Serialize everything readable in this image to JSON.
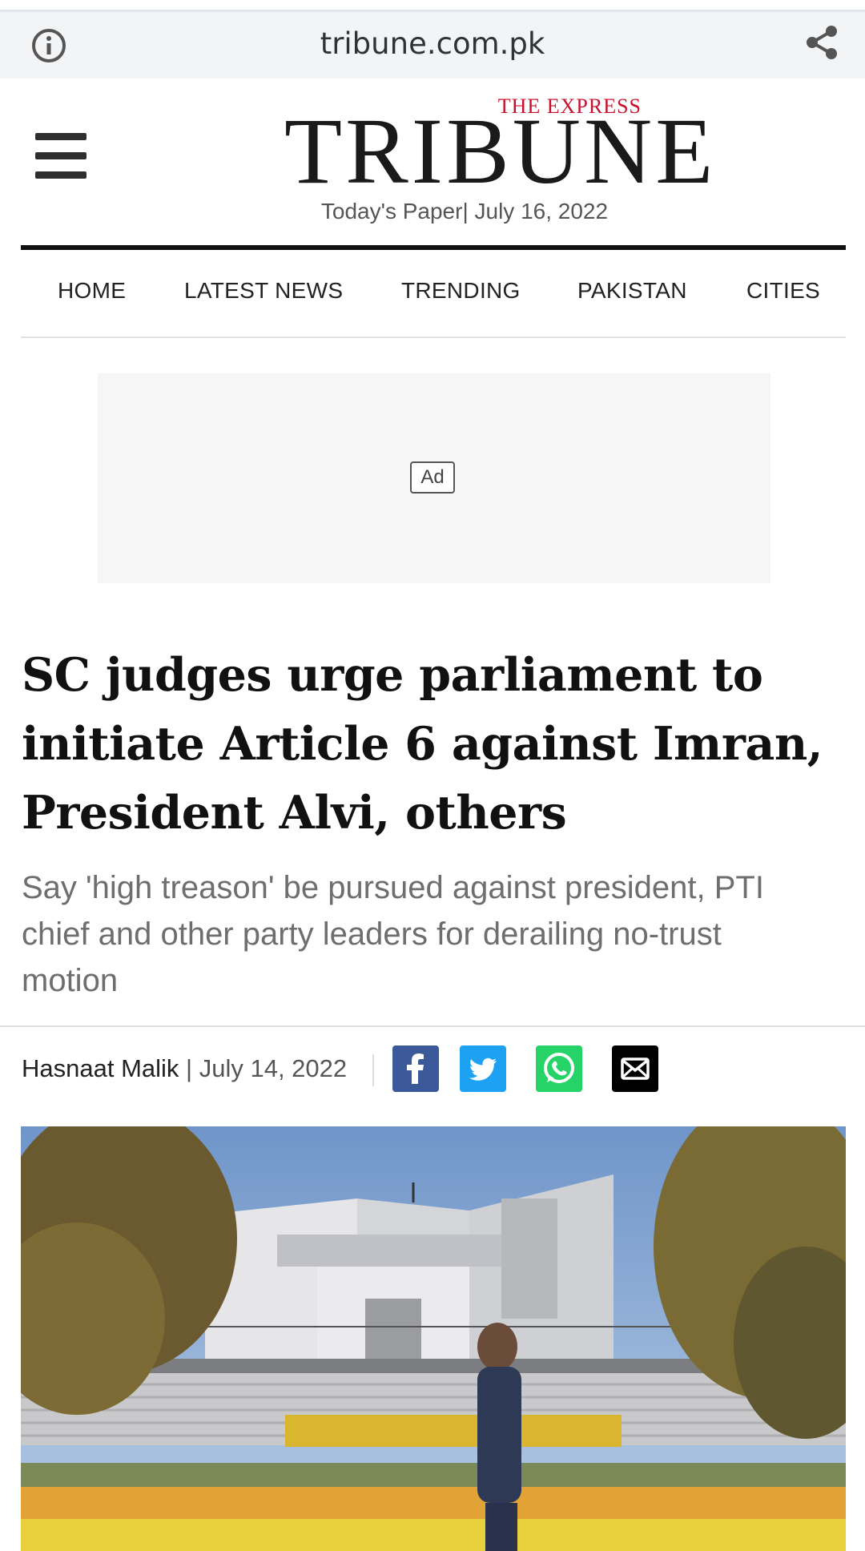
{
  "browser": {
    "url": "tribune.com.pk",
    "icons": {
      "info": "info-icon",
      "share": "share-icon"
    }
  },
  "masthead": {
    "logo_small": "THE EXPRESS",
    "logo_main": "TRIBUNE",
    "todays_paper": "Today's Paper",
    "date_sep": "|",
    "date": "July 16, 2022",
    "menu_icon": "hamburger-menu-icon"
  },
  "nav": {
    "items": [
      "HOME",
      "LATEST NEWS",
      "TRENDING",
      "PAKISTAN",
      "CITIES"
    ]
  },
  "ad": {
    "label": "Ad"
  },
  "article": {
    "headline": "SC judges urge parliament to initiate Article 6 against Imran, President Alvi, others",
    "subheadline": "Say 'high treason' be pursued against president, PTI chief and other party leaders for derailing no-trust motion",
    "author": "Hasnaat Malik",
    "byline_sep": "|",
    "date": "July 14, 2022",
    "share_icons": [
      "facebook-icon",
      "twitter-icon",
      "whatsapp-icon",
      "email-icon"
    ]
  },
  "colors": {
    "logo_accent": "#c8102e",
    "facebook": "#3b5998",
    "twitter": "#1da1f2",
    "whatsapp": "#25d366",
    "email": "#000000"
  }
}
